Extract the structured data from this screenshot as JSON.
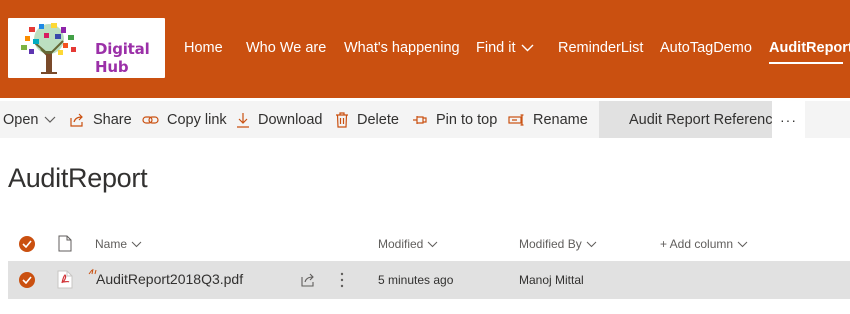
{
  "header": {
    "logo_text": "Digital Hub",
    "nav": [
      {
        "label": "Home"
      },
      {
        "label": "Who We are"
      },
      {
        "label": "What's happening"
      },
      {
        "label": "Find it"
      },
      {
        "label": "ReminderList"
      },
      {
        "label": "AutoTagDemo"
      },
      {
        "label": "AuditReport"
      }
    ],
    "active_item": "AuditReport",
    "bar_color": "#ca5010"
  },
  "commandbar": {
    "open": "Open",
    "share": "Share",
    "copy_link": "Copy link",
    "download": "Download",
    "delete": "Delete",
    "pin_to_top": "Pin to top",
    "rename": "Rename",
    "custom_action": "Audit Report Reference",
    "more": "···"
  },
  "page": {
    "title": "AuditReport"
  },
  "list": {
    "columns": {
      "name": "Name",
      "modified": "Modified",
      "modified_by": "Modified By",
      "add_column": "+ Add column"
    },
    "rows": [
      {
        "name": "AuditReport2018Q3.pdf",
        "modified": "5 minutes ago",
        "modified_by": "Manoj Mittal",
        "selected": true,
        "file_type_icon": "pdf-icon"
      }
    ]
  },
  "colors": {
    "accent": "#ca5010",
    "selected_row": "#e1e1e1",
    "commandbar_bg": "#f4f4f4"
  }
}
